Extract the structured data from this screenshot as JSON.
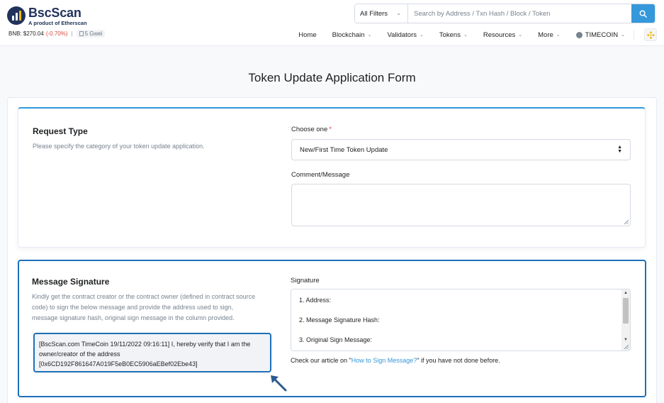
{
  "header": {
    "brand_name": "BscScan",
    "brand_sub": "A product of Etherscan",
    "price_label": "BNB: $270.04",
    "price_change": "(-0.70%)",
    "price_sep": "|",
    "gas_label": "5 Gwei",
    "search": {
      "filter_label": "All Filters",
      "placeholder": "Search by Address / Txn Hash / Block / Token"
    },
    "nav": {
      "home": "Home",
      "blockchain": "Blockchain",
      "validators": "Validators",
      "tokens": "Tokens",
      "resources": "Resources",
      "more": "More",
      "user": "TIMECOIN"
    }
  },
  "page_title": "Token Update Application Form",
  "request_type": {
    "title": "Request Type",
    "description": "Please specify the category of your token update application.",
    "choose_label": "Choose one",
    "required_mark": "*",
    "selected_option": "New/First Time Token Update",
    "comment_label": "Comment/Message",
    "comment_value": ""
  },
  "message_signature": {
    "title": "Message Signature",
    "description_line1": "Kindly get the contract creator or the contract owner (defined in contract source",
    "description_line2": "code) to sign the below message and provide the address used to sign,",
    "description_line3": "message signature hash, original sign message in the column provided.",
    "message_line1": "[BscScan.com TimeCoin 19/11/2022 09:16:11] I, hereby verify that I am the",
    "message_line2": "owner/creator of the address",
    "message_line3": "[0x6CD192F861647A019F5eB0EC5906aEBef02Ebe43]",
    "signature_label": "Signature",
    "signature_line1": "1. Address:",
    "signature_line2": "2. Message Signature Hash:",
    "signature_line3": "3. Original Sign Message:",
    "help_prefix": "Check our article on \"",
    "help_link": "How to Sign Message?",
    "help_suffix": "\" if you have not done before."
  },
  "colors": {
    "brand": "#21325b",
    "accent": "#3498db",
    "highlight_border": "#1d6fb8",
    "negative": "#de4437",
    "bnb_yellow": "#f0b90b"
  }
}
